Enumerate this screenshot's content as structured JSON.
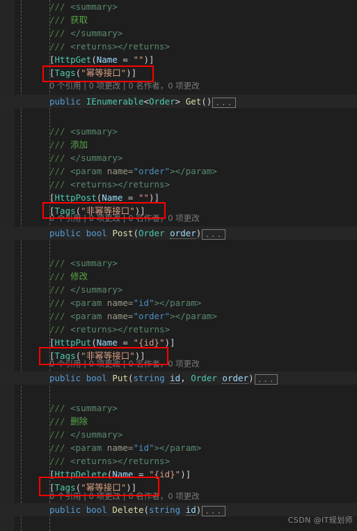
{
  "editor": {
    "background": "#1e1e1e",
    "gutter_background": "#252526",
    "highlight_background": "#262626",
    "indent_guide_color": "#6e6e6e",
    "annotation_color": "#ff0000"
  },
  "codelens_text": "0 个引用 | 0 项更改 | 0 名作者，0 项更改",
  "ellipsis": "...",
  "watermark": "CSDN @IT规划师",
  "blocks": [
    {
      "id": "get",
      "summary_open": "/// <summary>",
      "summary_slash": "///",
      "summary_tag_open": "<summary>",
      "summary_text_slash": "///",
      "summary_text": "获取",
      "summary_tag_close": "</summary>",
      "returns_tag": "<returns></returns>",
      "http_attribute": "[HttpGet(Name = \"\")]",
      "http_attr_name": "HttpGet",
      "http_arg_name": "Name",
      "http_arg_value": "\"\"",
      "tags_attribute": "[Tags(\"幂等接口\")]",
      "tags_attr_name": "Tags",
      "tags_value": "\"幂等接口\"",
      "signature": "public IEnumerable<Order> Get()",
      "sig_modifier": "public",
      "sig_return_type": "IEnumerable",
      "sig_generic_arg": "Order",
      "sig_method": "Get",
      "params": []
    },
    {
      "id": "post",
      "summary_slash": "///",
      "summary_tag_open": "<summary>",
      "summary_text": "添加",
      "summary_tag_close": "</summary>",
      "param_tag_name": "name=",
      "param_value": "\"order\"",
      "returns_tag": "<returns></returns>",
      "http_attr_name": "HttpPost",
      "http_arg_name": "Name",
      "http_arg_value": "\"\"",
      "tags_attr_name": "Tags",
      "tags_value": "\"非幂等接口\"",
      "sig_modifier": "public",
      "sig_return_type": "bool",
      "sig_method": "Post",
      "param_type_1": "Order",
      "param_name_1": "order"
    },
    {
      "id": "put",
      "summary_text": "修改",
      "param_value_1": "\"id\"",
      "param_value_2": "\"order\"",
      "http_attr_name": "HttpPut",
      "http_arg_name": "Name",
      "http_arg_value": "\"{id}\"",
      "tags_attr_name": "Tags",
      "tags_value": "\"非幂等接口\"",
      "sig_modifier": "public",
      "sig_return_type": "bool",
      "sig_method": "Put",
      "param_type_1": "string",
      "param_name_1": "id",
      "param_type_2": "Order",
      "param_name_2": "order"
    },
    {
      "id": "delete",
      "summary_text": "删除",
      "param_value_1": "\"id\"",
      "http_attr_name": "HttpDelete",
      "http_arg_name": "Name",
      "http_arg_value": "\"{id}\"",
      "tags_attr_name": "Tags",
      "tags_value": "\"幂等接口\"",
      "sig_modifier": "public",
      "sig_return_type": "bool",
      "sig_method": "Delete",
      "param_type_1": "string",
      "param_name_1": "id"
    }
  ],
  "common": {
    "slash": "///",
    "summary_open": "<summary>",
    "summary_close": "</summary>",
    "param_open": "<param",
    "param_attr": "name=",
    "param_close": "></param>",
    "returns": "<returns></returns>",
    "bracket_open": "[",
    "bracket_close": ")]",
    "paren_open": "(",
    "paren_close": ")",
    "equals": "=",
    "comma": ",",
    "angle_open": "<",
    "angle_close": ">",
    "tags_name": "Tags"
  }
}
